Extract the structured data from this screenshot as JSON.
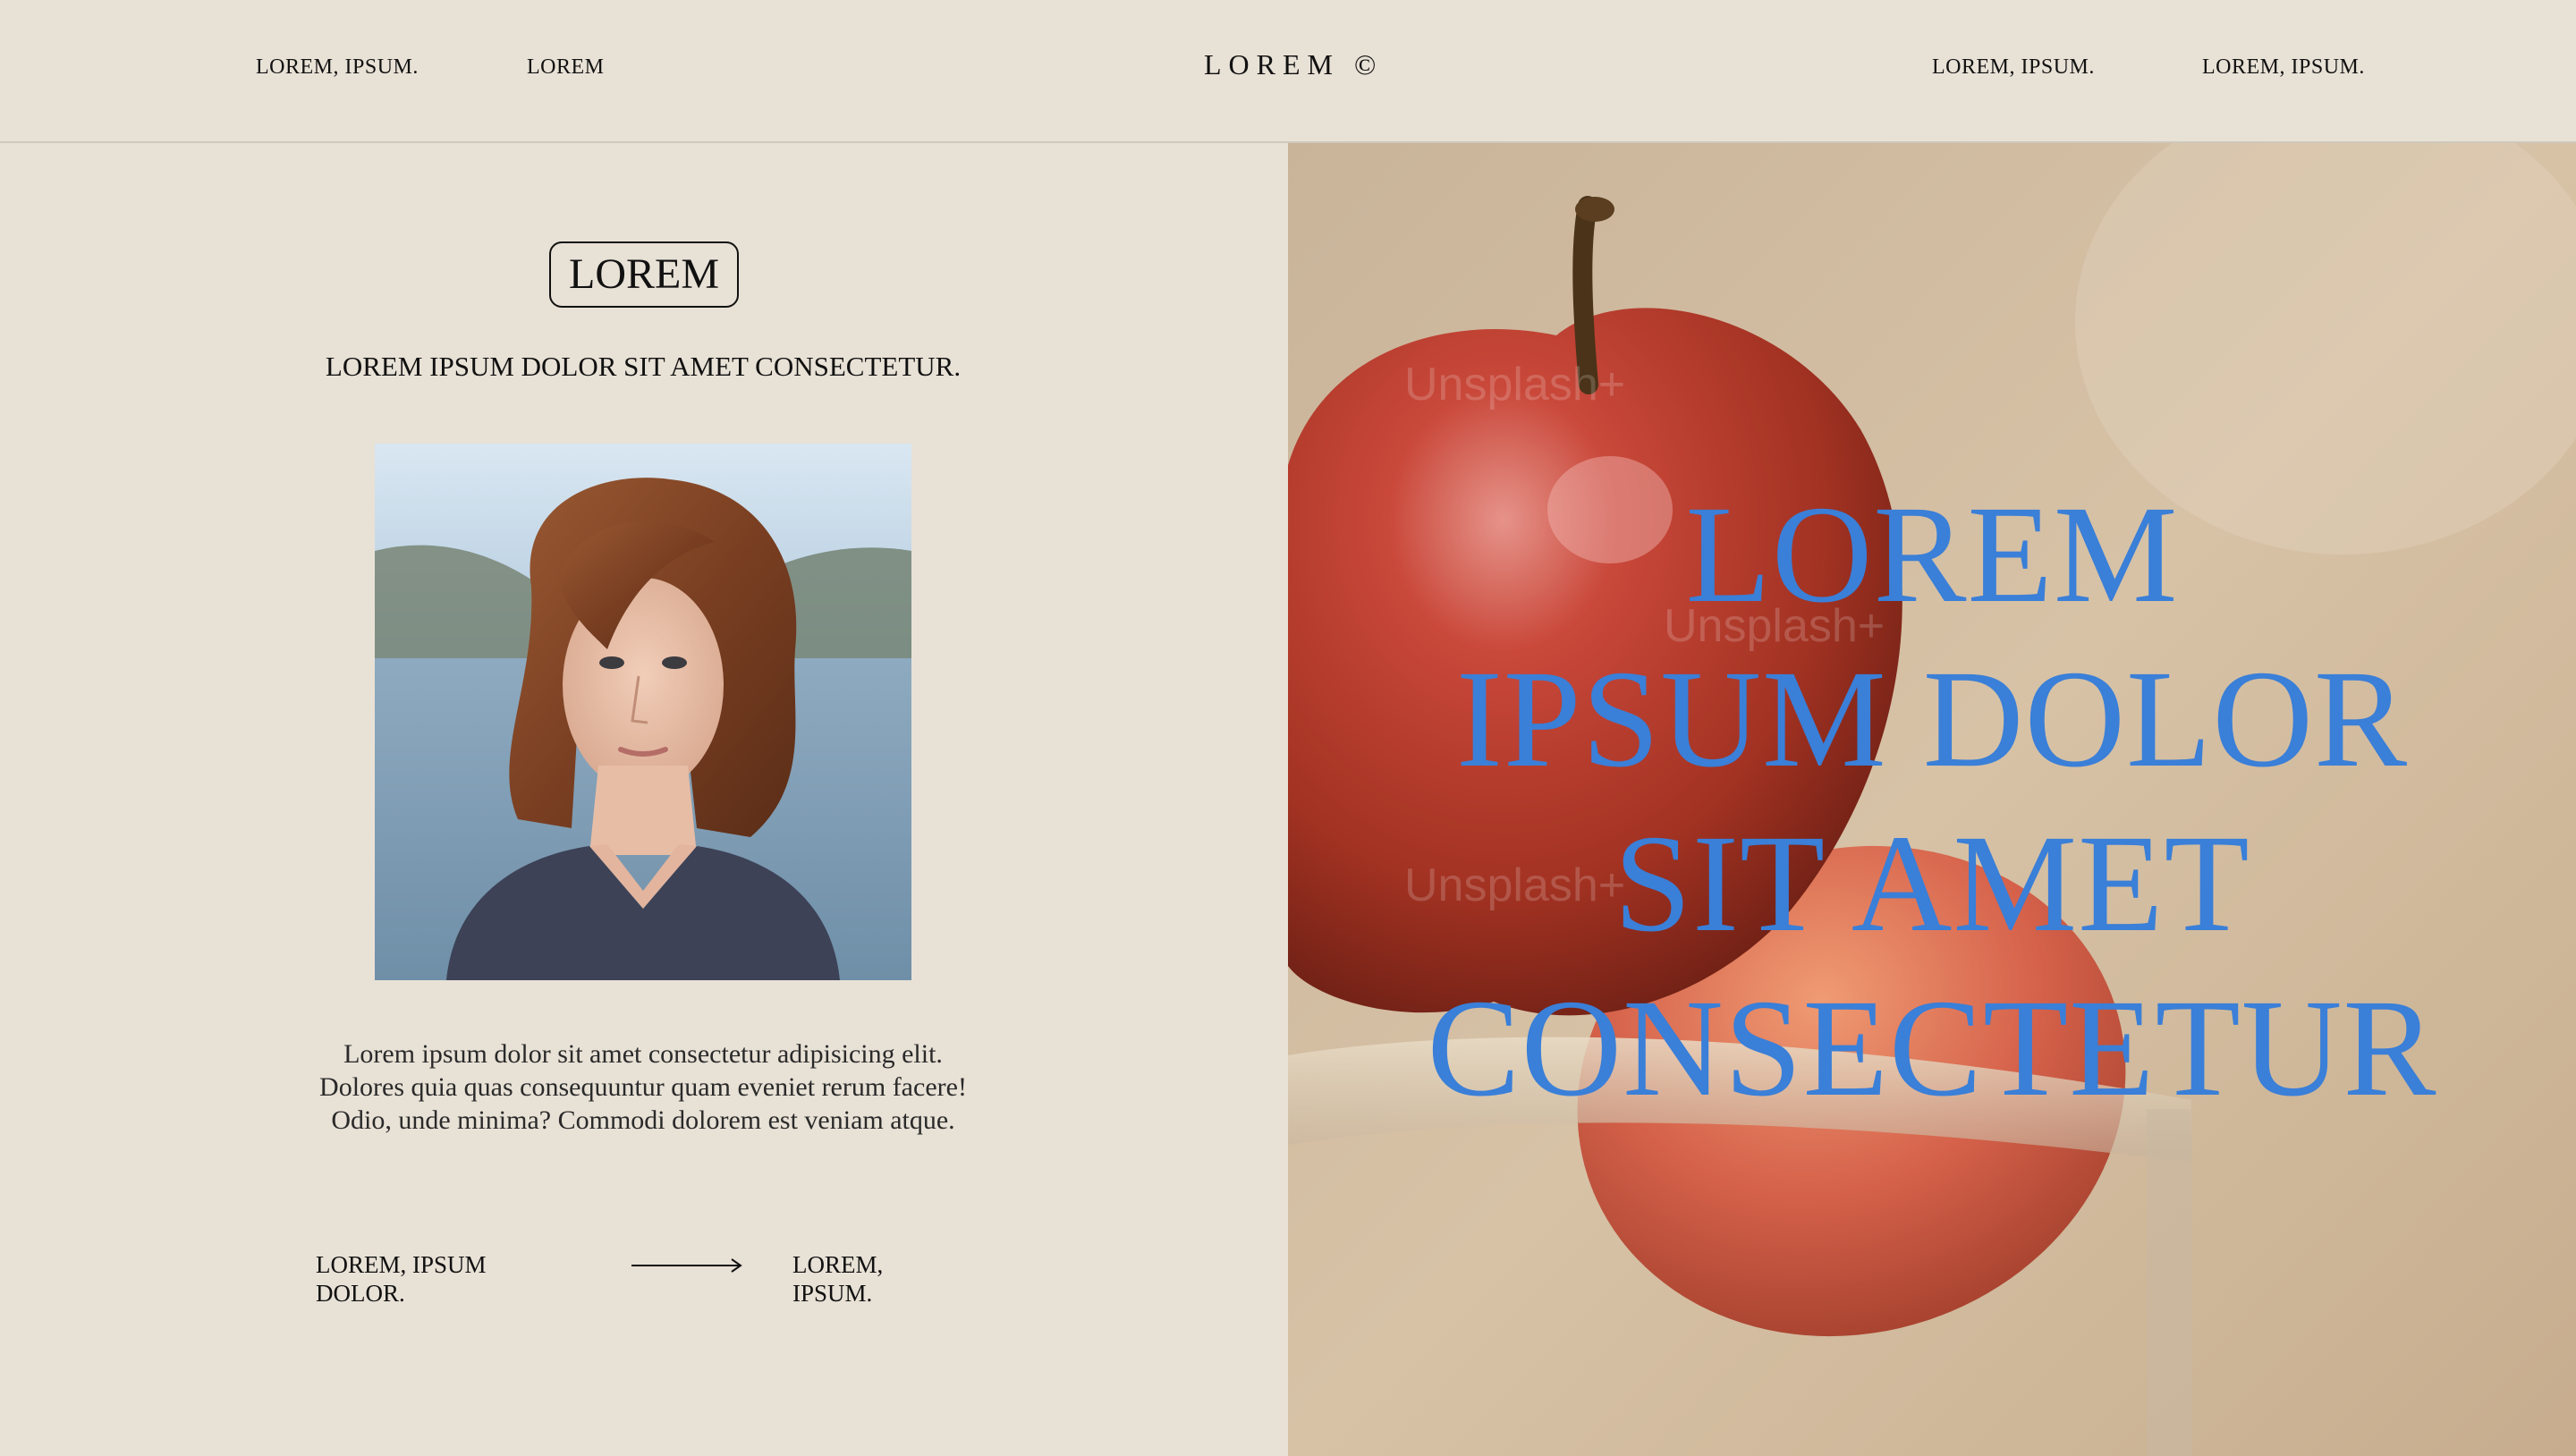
{
  "nav": {
    "left_links": [
      "LOREM, IPSUM.",
      "LOREM"
    ],
    "brand": "LOREM ©",
    "right_links": [
      "LOREM, IPSUM.",
      "LOREM, IPSUM."
    ]
  },
  "left_panel": {
    "pill_label": "LOREM",
    "subtitle": "LOREM IPSUM DOLOR SIT AMET CONSECTETUR.",
    "paragraph_lines": [
      "Lorem ipsum dolor sit amet consectetur adipisicing elit.",
      "Dolores quia quas consequuntur quam eveniet rerum facere!",
      "Odio, unde minima? Commodi dolorem est veniam atque."
    ],
    "bottom_left": [
      "LOREM, IPSUM",
      "DOLOR."
    ],
    "bottom_right": [
      "LOREM,",
      "IPSUM."
    ]
  },
  "hero": {
    "heading_lines": [
      "LOREM",
      "IPSUM DOLOR",
      "SIT AMET",
      "CONSECTETUR"
    ],
    "watermark": "Unsplash+"
  },
  "colors": {
    "background": "#e8e1d6",
    "hero_text": "#3a7fd8"
  },
  "icons": [
    "arrow-right-icon"
  ]
}
